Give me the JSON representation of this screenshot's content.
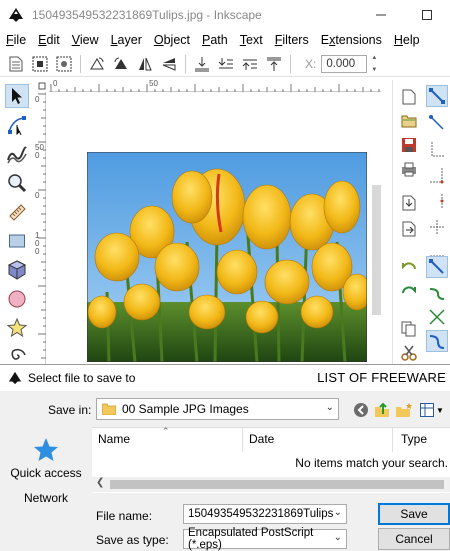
{
  "window": {
    "title": "150493549532231869Tulips.jpg - Inkscape",
    "icons": [
      "inkscape-icon",
      "minimize-icon",
      "maximize-icon"
    ]
  },
  "menu": {
    "items": [
      {
        "label": "File",
        "mnemonic": "F",
        "rest": "ile"
      },
      {
        "label": "Edit",
        "mnemonic": "E",
        "rest": "dit"
      },
      {
        "label": "View",
        "mnemonic": "V",
        "rest": "iew"
      },
      {
        "label": "Layer",
        "mnemonic": "L",
        "rest": "ayer"
      },
      {
        "label": "Object",
        "mnemonic": "O",
        "rest": "bject"
      },
      {
        "label": "Path",
        "mnemonic": "P",
        "rest": "ath"
      },
      {
        "label": "Text",
        "mnemonic": "T",
        "rest": "ext"
      },
      {
        "label": "Filters",
        "mnemonic": "F",
        "rest": "ilters"
      },
      {
        "label": "Extensions",
        "mnemonic": "x",
        "prefix": "E",
        "rest": "tensions"
      },
      {
        "label": "Help",
        "mnemonic": "H",
        "rest": "elp"
      }
    ]
  },
  "toolbar": {
    "x_label": "X:",
    "x_value": "0.000"
  },
  "ruler": {
    "h_labels": [
      "0",
      "50"
    ],
    "v_labels": [
      "0",
      "50",
      "0",
      "0",
      "1",
      "0",
      "0"
    ]
  },
  "dialog": {
    "title": "Select file to save to",
    "watermark": "LIST OF FREEWARE",
    "save_in_label": "Save in:",
    "save_in_value": "00 Sample JPG Images",
    "places": [
      "Quick access",
      "Network"
    ],
    "columns": [
      "Name",
      "Date",
      "Type"
    ],
    "empty_message": "No items match your search.",
    "file_name_label": "File name:",
    "file_name_value": "150493549532231869Tulips",
    "save_as_type_label": "Save as type:",
    "save_as_type_value": "Encapsulated PostScript (*.eps)",
    "save_button": "Save",
    "cancel_button": "Cancel"
  },
  "colors": {
    "accent": "#0078d7",
    "active_tool_bg": "#cfe3f5",
    "sky": "#6fb2e8",
    "tulip": "#f2b817",
    "grass": "#3c6d1e"
  }
}
